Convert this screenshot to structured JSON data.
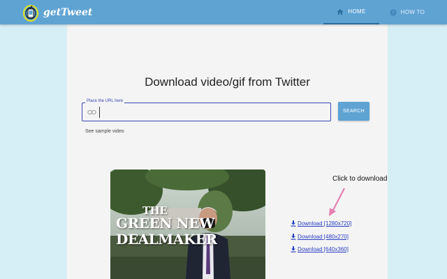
{
  "app": {
    "name": "getTweet"
  },
  "nav": {
    "home_label": "HOME",
    "howto_label": "HOW TO"
  },
  "main": {
    "title": "Download video/gif from Twitter",
    "url_field": {
      "legend": "Place the URL here",
      "value": "",
      "icon": "link-icon"
    },
    "search_label": "SEARCH",
    "sample_link": "See sample video"
  },
  "video": {
    "thumbnail_text": [
      "THE",
      "GREEN NEW",
      "DEALMAKER"
    ]
  },
  "downloads": {
    "callout": "Click to download",
    "items": [
      {
        "label": "Download [1280x720]"
      },
      {
        "label": "Download [480x270]"
      },
      {
        "label": "Download [640x360]"
      }
    ]
  },
  "colors": {
    "navbar": "#5fa3d3",
    "page_bg": "#d6eef5",
    "content_bg": "#f4f4f4",
    "field_border": "#3a47b5",
    "link": "#2a3fc2",
    "arrow": "#e57fb0"
  }
}
